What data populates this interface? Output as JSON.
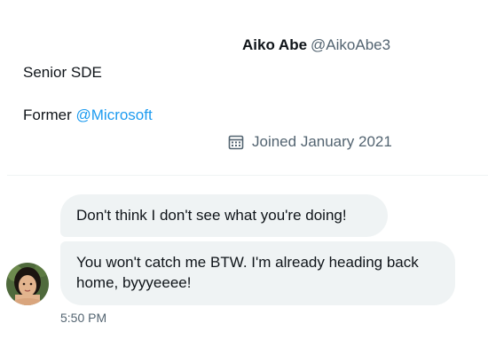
{
  "profile": {
    "display_name": "Aiko Abe",
    "handle": "@AikoAbe3",
    "bio_title": "Senior SDE",
    "bio_former_prefix": "Former ",
    "bio_former_mention": "@Microsoft",
    "joined": "Joined January 2021",
    "joined_icon": "calendar-icon"
  },
  "conversation": {
    "messages": [
      {
        "text": "Don't think I don't see what you're doing!"
      },
      {
        "text": "You won't catch me BTW. I'm already heading back home, byyyeeee!"
      }
    ],
    "timestamp": "5:50 PM",
    "avatar_icon": "avatar"
  },
  "colors": {
    "accent": "#1d9bf0",
    "secondary_text": "#536471",
    "bubble_bg": "#eff3f4",
    "divider": "#eff3f4"
  }
}
